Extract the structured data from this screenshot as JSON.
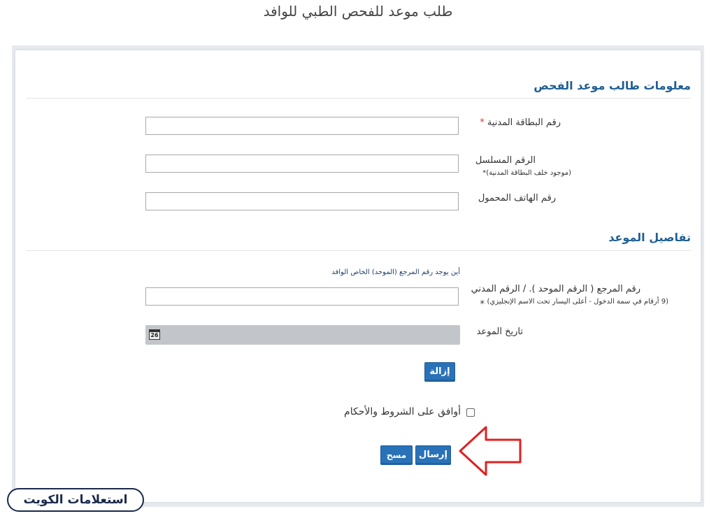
{
  "page": {
    "title": "طلب موعد للفحص الطبي للوافد"
  },
  "applicant_section": {
    "title": "معلومات طالب موعد الفحص",
    "civil_id": {
      "label": "رقم البطاقة المدنية",
      "required_mark": "*",
      "value": ""
    },
    "serial_number": {
      "label": "الرقم المسلسل",
      "hint": "(موجود خلف البطاقة المدنية)",
      "required_mark": "*",
      "value": ""
    },
    "mobile": {
      "label": "رقم الهاتف المحمول",
      "value": ""
    }
  },
  "appointment_section": {
    "title": "تفاصيل الموعد",
    "reference_link": "أين يوجد رقم المرجع (الموحد) الخاص الوافد",
    "reference_number": {
      "label": "رقم المرجع ( الرقم الموحد ). / الرقم المدني",
      "hint": "(9 أرقام في سمة الدخول - أعلى اليسار تحت الاسم الإنجليزي)",
      "required_mark": "*",
      "value": ""
    },
    "date": {
      "label": "تاريخ الموعد",
      "icon": "calendar-icon",
      "icon_text": "26",
      "value": ""
    },
    "remove_label": "إزالة"
  },
  "terms": {
    "label": "أوافق على الشروط والأحكام",
    "checked": false
  },
  "actions": {
    "submit_label": "إرسال",
    "clear_label": "مسح"
  },
  "watermark": {
    "text": "استعلامات الكويت"
  },
  "colors": {
    "accent": "#2a72b8",
    "heading": "#1f5f94",
    "required": "#d63b3b",
    "arrow": "#e02020"
  }
}
